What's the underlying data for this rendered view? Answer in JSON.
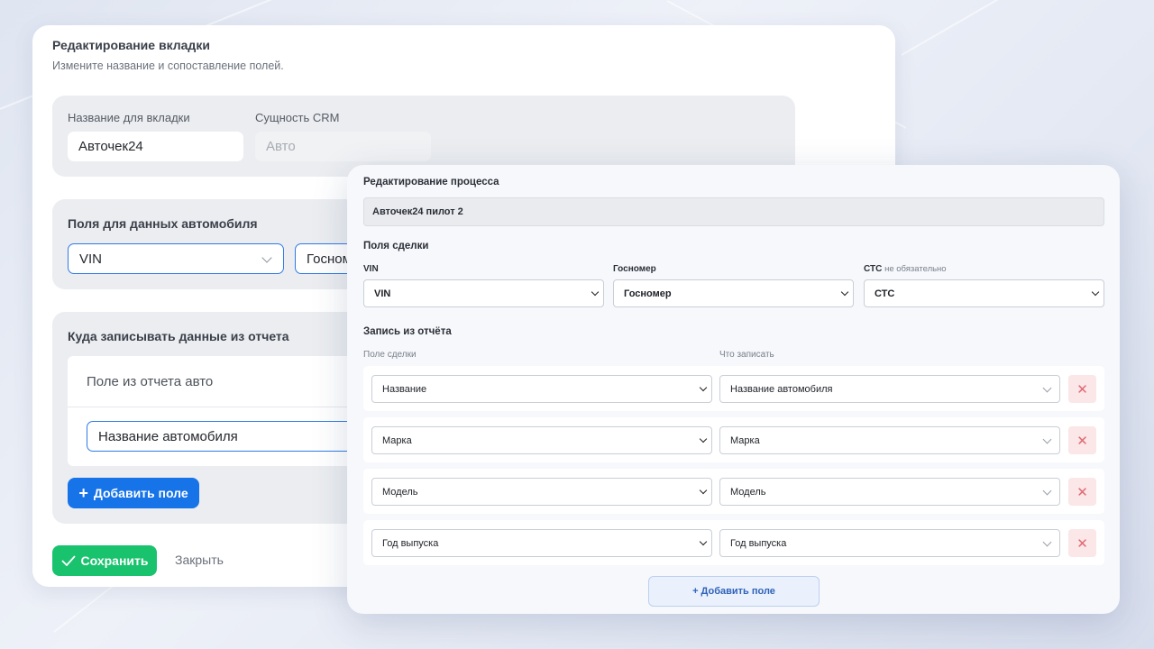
{
  "back_panel": {
    "title": "Редактирование вкладки",
    "subtitle": "Измените название и сопоставление полей.",
    "tab_name_label": "Название для вкладки",
    "tab_name_value": "Авточек24",
    "entity_label": "Сущность CRM",
    "entity_value": "Авто",
    "car_fields_heading": "Поля для данных автомобиля",
    "car_field_1": "VIN",
    "car_field_2": "Госном",
    "report_heading": "Куда записывать данные из отчета",
    "report_field_label": "Поле из отчета авто",
    "report_field_value": "Название автомобиля",
    "add_field_label": "Добавить поле",
    "save_label": "Сохранить",
    "close_label": "Закрыть"
  },
  "front_panel": {
    "title": "Редактирование процесса",
    "process_name": "Авточек24 пилот 2",
    "deal_fields_heading": "Поля сделки",
    "vin_label": "VIN",
    "vin_value": "VIN",
    "gosnomer_label": "Госномер",
    "gosnomer_value": "Госномер",
    "sts_label": "СТС",
    "sts_optional": "не обязательно",
    "sts_value": "СТС",
    "report_heading": "Запись из отчёта",
    "col_deal_field": "Поле сделки",
    "col_what_write": "Что записать",
    "rows": [
      {
        "deal_field": "Название",
        "value": "Название автомобиля"
      },
      {
        "deal_field": "Марка",
        "value": "Марка"
      },
      {
        "deal_field": "Модель",
        "value": "Модель"
      },
      {
        "deal_field": "Год выпуска",
        "value": "Год выпуска"
      }
    ],
    "add_field_label": "+ Добавить поле"
  },
  "icons": {
    "plus": "plus-icon",
    "check": "check-icon",
    "delete": "close-icon",
    "dropdown": "chevron-down-icon"
  },
  "colors": {
    "primary": "#1673e8",
    "success": "#19c36e",
    "danger_bg": "#fbe6e8",
    "danger_icon": "#e06a73"
  }
}
